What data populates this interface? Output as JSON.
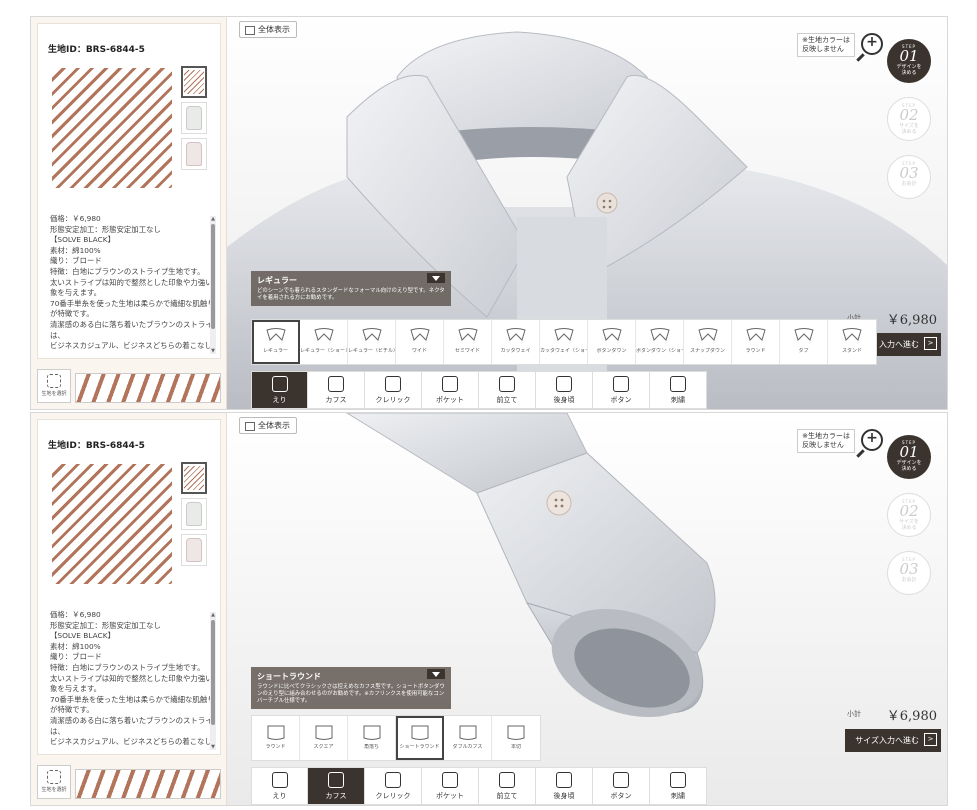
{
  "fabric": {
    "id_label": "生地ID：BRS-6844-5",
    "price": "価格：￥6,980",
    "treatment": "形態安定加工：形態安定加工なし",
    "brand": "【SOLVE BLACK】",
    "material": "素材：綿100%",
    "weave": "織り：ブロード",
    "lines": [
      "特徴：白地にブラウンのストライプ生地です。",
      "太いストライプは知的で整然とした印象や力強い印",
      "象を与えます。",
      "70番手単糸を使った生地は柔らかで繊細な肌触り",
      "が特徴です。",
      "清潔感のある白に落ち着いたブラウンのストライプ",
      "は、",
      "ビジネスカジュアル、ビジネスどちらの着こなしに"
    ],
    "select_label": "生地を選択"
  },
  "stage": {
    "view_all": "全体表示",
    "note_line1": "※生地カラーは",
    "note_line2": "反映しません"
  },
  "steps": [
    {
      "tag": "STEP",
      "num": "01",
      "label1": "デザインを",
      "label2": "決める"
    },
    {
      "tag": "STEP",
      "num": "02",
      "label1": "サイズを",
      "label2": "決める"
    },
    {
      "tag": "STEP",
      "num": "03",
      "label1": "お会計",
      "label2": ""
    }
  ],
  "panel1": {
    "info_title": "レギュラー",
    "info_desc": "どのシーンでも着られるスタンダードなフォーマル向けのえり型です。ネクタイを着用される方にお勧めです。",
    "options": [
      "レギュラー",
      "レギュラー（ショート）",
      "レギュラー（ビチル）",
      "ワイド",
      "セミワイド",
      "カッタウェイ",
      "カッタウェイ（ショート）",
      "ボタンダウン",
      "ボタンダウン（ショート）",
      "スナップダウン",
      "ラウンド",
      "タブ",
      "スタンド"
    ],
    "price_label": "小計",
    "price": "￥6,980",
    "next": "入力へ進む"
  },
  "panel2": {
    "info_title": "ショートラウンド",
    "info_desc": "ラウンドに比べてクラシックさは控えめなカフス型です。ショートボタンダウンのえり型に組み合わせるのがお勧めです。※カフリンクスを使用可能なコンバーチブル仕様です。",
    "options": [
      "ラウンド",
      "スクエア",
      "角落ち",
      "ショートラウンド",
      "ダブルカフス",
      "本切"
    ],
    "price_label": "小計",
    "price": "￥6,980",
    "next": "サイズ入力へ進む"
  },
  "tabs": [
    "えり",
    "カフス",
    "クレリック",
    "ポケット",
    "前立て",
    "後身頃",
    "ボタン",
    "刺繍"
  ],
  "colors": {
    "accent": "#3b342e",
    "stripe": "#b3745c"
  }
}
